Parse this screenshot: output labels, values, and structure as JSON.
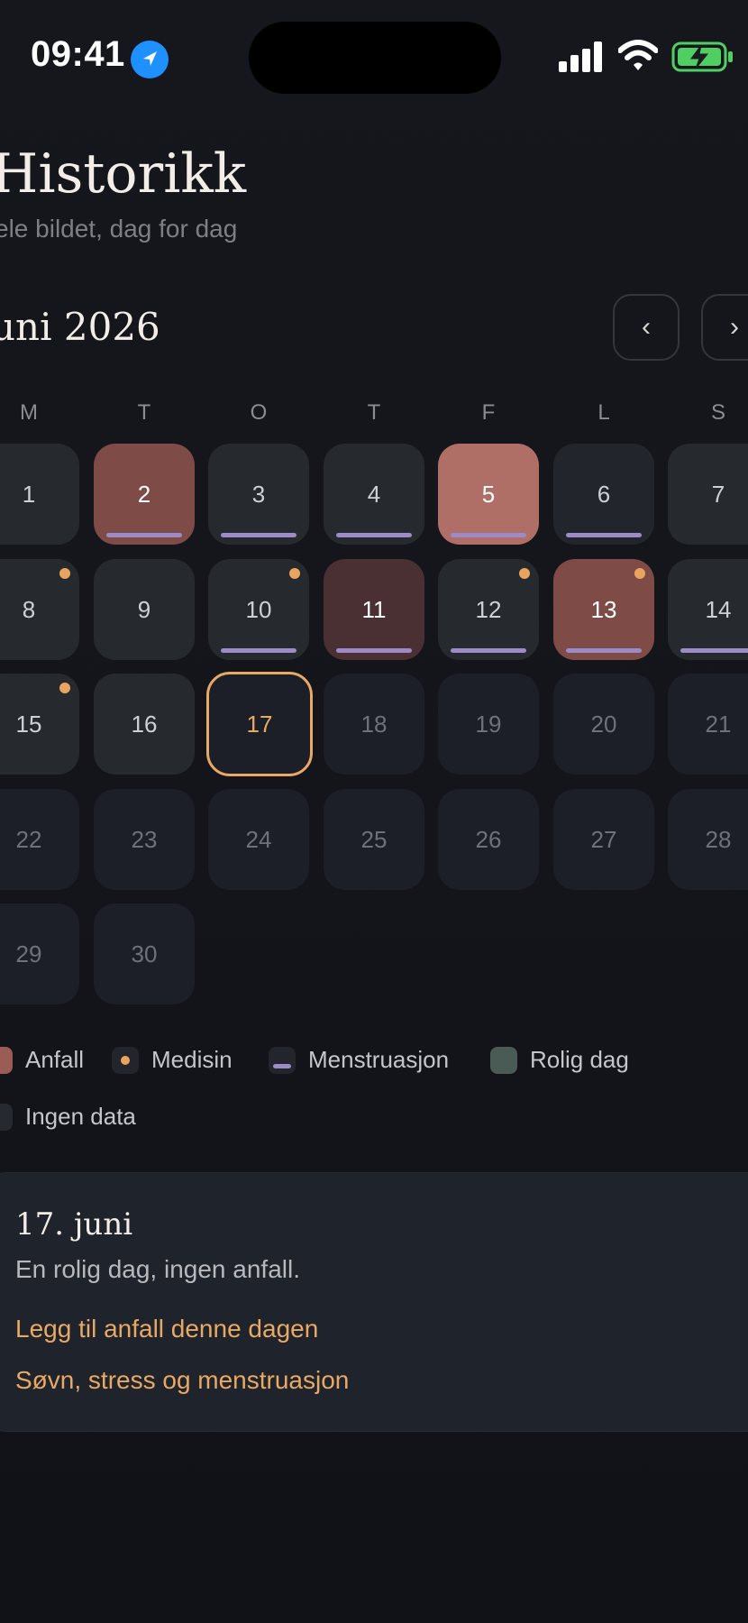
{
  "status_bar": {
    "time": "09:41"
  },
  "header": {
    "title": "Historikk",
    "subtitle": "ele bildet, dag for dag"
  },
  "calendar": {
    "month_label": "uni 2026",
    "prev_label": "‹",
    "next_label": "›",
    "weekdays": [
      "M",
      "T",
      "O",
      "T",
      "F",
      "L",
      "S"
    ],
    "days": [
      {
        "n": "1"
      },
      {
        "n": "2"
      },
      {
        "n": "3"
      },
      {
        "n": "4"
      },
      {
        "n": "5"
      },
      {
        "n": "6"
      },
      {
        "n": "7"
      },
      {
        "n": "8"
      },
      {
        "n": "9"
      },
      {
        "n": "10"
      },
      {
        "n": "11"
      },
      {
        "n": "12"
      },
      {
        "n": "13"
      },
      {
        "n": "14"
      },
      {
        "n": "15"
      },
      {
        "n": "16"
      },
      {
        "n": "17"
      },
      {
        "n": "18"
      },
      {
        "n": "19"
      },
      {
        "n": "20"
      },
      {
        "n": "21"
      },
      {
        "n": "22"
      },
      {
        "n": "23"
      },
      {
        "n": "24"
      },
      {
        "n": "25"
      },
      {
        "n": "26"
      },
      {
        "n": "27"
      },
      {
        "n": "28"
      },
      {
        "n": "29"
      },
      {
        "n": "30"
      }
    ]
  },
  "legend": {
    "seizure": "Anfall",
    "medicine": "Medisin",
    "menstruation": "Menstruasjon",
    "calm": "Rolig dag",
    "no_data": "Ingen data"
  },
  "detail": {
    "date": "17. juni",
    "description": "En rolig dag, ingen anfall.",
    "add_link": "Legg til anfall denne dagen",
    "factors_link": "Søvn, stress og menstruasjon"
  },
  "colors": {
    "accent": "#e8a964",
    "seizure": "#b06f66",
    "menstruation": "#9c8bc6",
    "calm": "#262a2e"
  }
}
